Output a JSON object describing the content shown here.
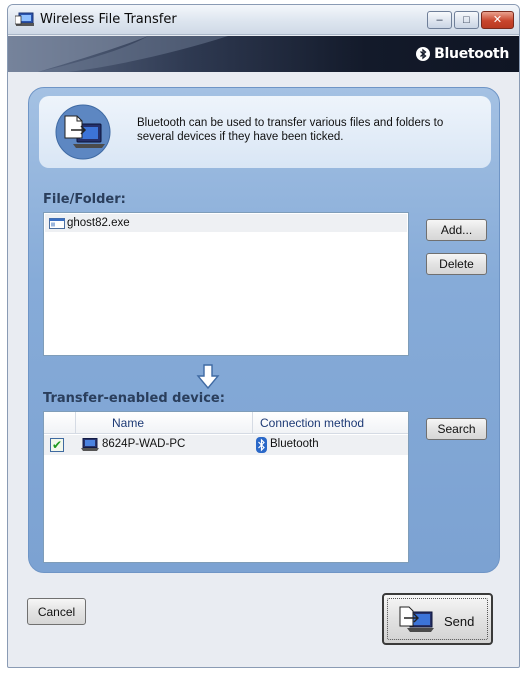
{
  "window": {
    "title": "Wireless File Transfer",
    "brand": "Bluetooth",
    "controls": {
      "minimize": "–",
      "maximize": "□",
      "close": "✕"
    }
  },
  "description": "Bluetooth can be used to transfer various files and folders to several devices if they have been ticked.",
  "files": {
    "title": "File/Folder:",
    "items": [
      {
        "name": "ghost82.exe",
        "icon": "exe-file-icon"
      }
    ],
    "add_label": "Add...",
    "delete_label": "Delete"
  },
  "devices": {
    "title": "Transfer-enabled device:",
    "columns": [
      "",
      "Name",
      "Connection method"
    ],
    "rows": [
      {
        "checked": true,
        "name": "8624P-WAD-PC",
        "connection": "Bluetooth"
      }
    ],
    "search_label": "Search"
  },
  "footer": {
    "cancel_label": "Cancel",
    "send_label": "Send"
  },
  "colors": {
    "panel": "#86abd8",
    "banner": "#131a2a",
    "close_button": "#c8452c",
    "check": "#1f9a1f"
  }
}
